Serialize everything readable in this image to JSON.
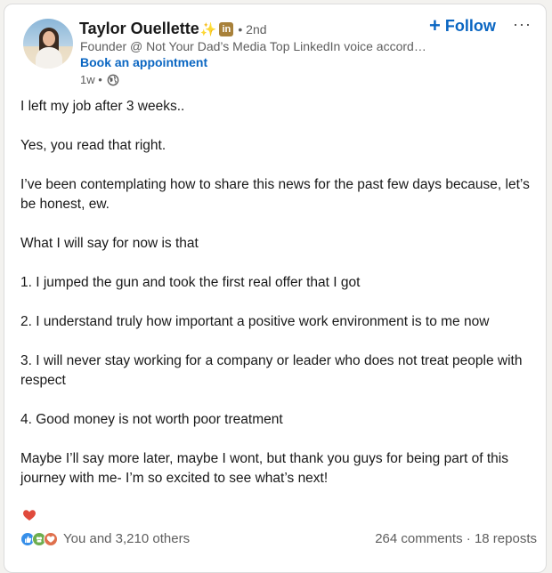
{
  "author": {
    "name": "Taylor Ouellette",
    "sparkle": "✨",
    "badge": "in",
    "degree": "• 2nd",
    "headline": "Founder @ Not Your Dad’s Media Top LinkedIn voice according to Favikon",
    "book_link": "Book an appointment",
    "time": "1w •"
  },
  "follow_label": "Follow",
  "follow_plus": "+",
  "more_label": "···",
  "post": {
    "paragraphs": [
      "I left my job after 3 weeks..",
      "Yes, you read that right.",
      "I’ve been contemplating how to share this news for the past few days because, let’s be honest, ew.",
      "What I will say for now is that",
      "1. I jumped the gun and took the first real offer that I got",
      "2. I understand truly how important a positive work environment is to me now",
      "3. I will never stay working for a company or leader who does not treat people with respect",
      "4. Good money is not worth poor treatment",
      "Maybe I’ll say more later, maybe I wont, but thank you guys for being part of this journey with me- I’m so excited to see what’s next!"
    ]
  },
  "social": {
    "reactions_text": "You and 3,210 others",
    "comments": "264 comments",
    "separator": " · ",
    "reposts": "18 reposts"
  },
  "colors": {
    "link": "#0a66c2",
    "like": "#378fe9",
    "celebrate": "#6dae4f",
    "love": "#df704d",
    "badge": "#a8813a"
  }
}
